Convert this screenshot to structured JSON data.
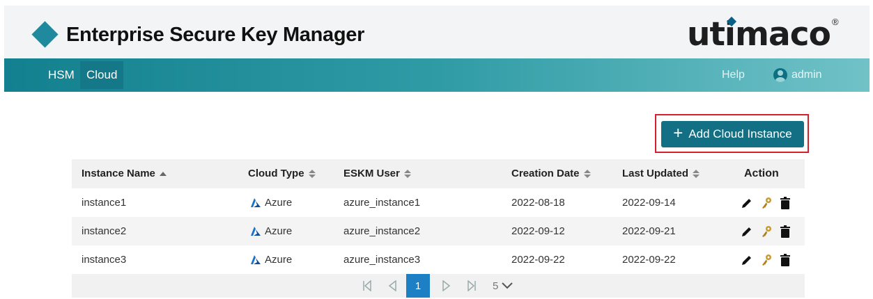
{
  "header": {
    "title": "Enterprise Secure Key Manager",
    "brand": "utimaco",
    "brand_mark": "®"
  },
  "nav": {
    "items": [
      {
        "label": "HSM"
      },
      {
        "label": "Cloud"
      }
    ],
    "active": "Cloud",
    "help": "Help",
    "user": "admin"
  },
  "add_button": {
    "label": "Add Cloud Instance",
    "icon": "plus-icon"
  },
  "table": {
    "columns": [
      "Instance Name",
      "Cloud Type",
      "ESKM User",
      "Creation Date",
      "Last Updated",
      "Action"
    ],
    "sorted_column": "Instance Name",
    "rows": [
      {
        "name": "instance1",
        "cloud": "Azure",
        "user": "azure_instance1",
        "created": "2022-08-18",
        "updated": "2022-09-14"
      },
      {
        "name": "instance2",
        "cloud": "Azure",
        "user": "azure_instance2",
        "created": "2022-09-12",
        "updated": "2022-09-21"
      },
      {
        "name": "instance3",
        "cloud": "Azure",
        "user": "azure_instance3",
        "created": "2022-09-22",
        "updated": "2022-09-22"
      }
    ]
  },
  "pagination": {
    "current_page": "1",
    "page_size": "5"
  },
  "colors": {
    "accent": "#136f84",
    "highlight": "#d3202b",
    "page_active": "#1d7fc4"
  }
}
